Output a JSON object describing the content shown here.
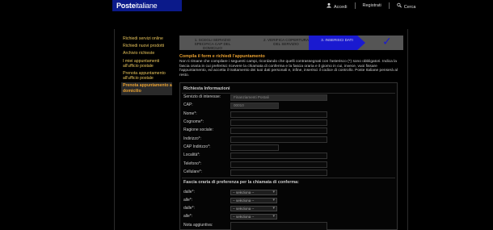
{
  "header": {
    "logo_bold": "Poste",
    "logo_light": "italiane",
    "nav": [
      {
        "label": "Accedi"
      },
      {
        "label": "Registrati"
      },
      {
        "label": "Cerca"
      }
    ]
  },
  "sidebar": {
    "items": [
      {
        "label": "Richiedi servizi online"
      },
      {
        "label": "Richiedi nuovi prodotti"
      },
      {
        "label": "Archivio richieste"
      },
      {
        "label": "I miei appuntamenti all'ufficio postale"
      },
      {
        "label": "Prenota appuntamento all'ufficio postale"
      },
      {
        "label": "Prenota appuntamento a domicilio"
      }
    ]
  },
  "stepper": {
    "step1": "1. SCEGLI SERVIZIO SPECIFICA CAP DEL DOMICILIO",
    "step2": "2. VERIFICA COPERTURA DEL SERVIZIO",
    "step3": "3. INSERISCI DATI"
  },
  "intro": {
    "title": "Compila il form e richiedi l'appuntamento",
    "text": "Non ti rimane che compilare i seguenti campi, ricordando che quelli contrassegnati con l'asterisco (*) sono obbligatori. Indica la fascia oraria in cui preferisci ricevere la chiamata di conferma e la fascia oraria e il giorno in cui, invece, vuoi fissare l'appuntamento, ed accetta il trattamento dei tuoi dati personali e, infine, inserisci il codice di controllo. Poste Italiane penserà al resto."
  },
  "form": {
    "title": "Richiesta Informazioni",
    "fields": [
      {
        "label": "Servizio di interesse:",
        "value": "Finanziamenti Postali"
      },
      {
        "label": "CAP:",
        "value": "00010"
      },
      {
        "label": "Nome*:",
        "value": ""
      },
      {
        "label": "Cognome*:",
        "value": ""
      },
      {
        "label": "Ragione sociale:",
        "value": ""
      },
      {
        "label": "Indirizzo*:",
        "value": ""
      },
      {
        "label": "CAP Indirizzo*:",
        "value": ""
      },
      {
        "label": "Località*:",
        "value": ""
      },
      {
        "label": "Telefono*:",
        "value": ""
      },
      {
        "label": "Cellulare*:",
        "value": ""
      }
    ],
    "section2_title": "Fascia oraria di preferenza per la chiamata di conferma:",
    "time_rows": [
      {
        "label": "dalle*:",
        "value": "-- seleziona --"
      },
      {
        "label": "alle*:",
        "value": "-- seleziona --"
      },
      {
        "label": "dalle*:",
        "value": "-- seleziona --"
      },
      {
        "label": "alle*:",
        "value": "-- seleziona --"
      }
    ],
    "notes_label": "Nota aggiuntiva:"
  }
}
